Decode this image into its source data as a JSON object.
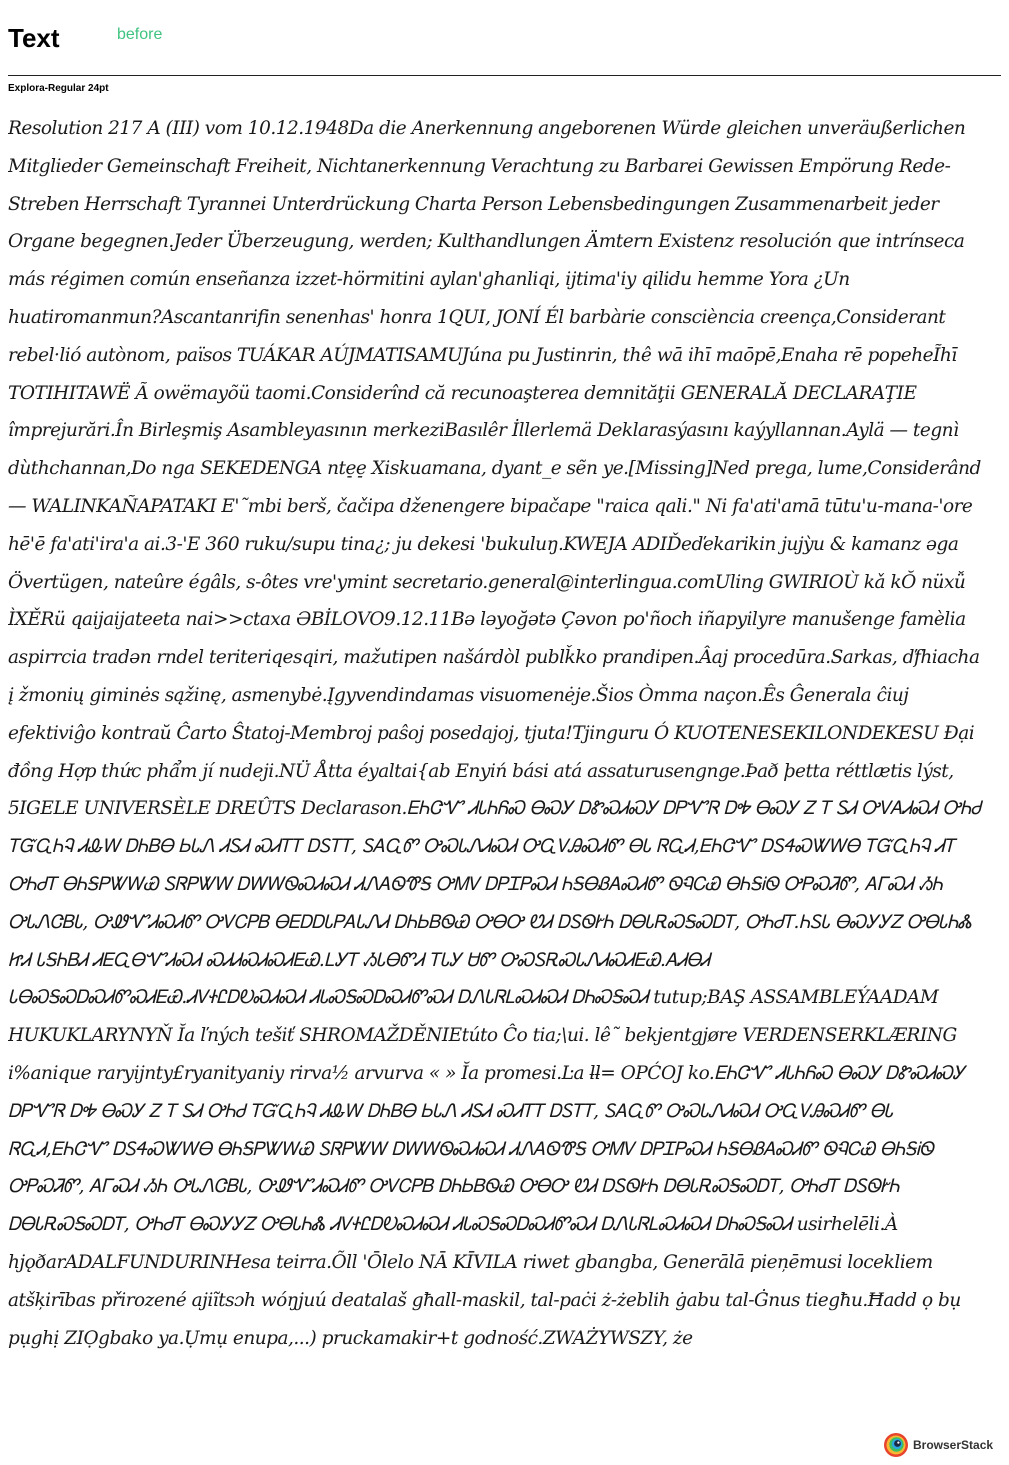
{
  "header": {
    "title": "Text",
    "tag": "before",
    "tag_color": "#3fc380"
  },
  "font_label": "Explora-Regular 24pt",
  "specimen_text": "Resolution 217 A (III) vom 10.12.1948Da die Anerkennung angeborenen Würde gleichen unveräußerlichen Mitglieder Gemeinschaft Freiheit, Nichtanerkennung Verachtung zu Barbarei Gewissen Empörung Rede- Streben Herrschaft Tyrannei Unterdrückung Charta Person Lebensbedingungen Zusammenarbeit jeder Organe begegnen.Jeder Überzeugung, werden; Kulthandlungen Ämtern Existenz resolución que intrínseca más régimen común enseñanza izzet-hörmitini aylan'ghanliqi, ijtima'iy qilidu hemme Yora ¿Un huatiromanmun?Ascantanrifin senenhas' honra 1QUI, JONÍ Él barbàrie consciència creença,Considerant rebel·lió autònom, països TUÁKAR AÚJMATISAMUJúna pu Justinrin, thê wā ihī maōpē,Enaha rē popeheĨhī TOTIHITAWË Ã owëmayõü taomi.Considerînd că recunoaşterea demnităţii GENERALĂ DECLARAŢIE împrejurări.În Birleşmiş Asambleyasının merkeziBasılêr İllerlemä Deklarasýasını kaýyllannan.Aylä — tegnì dùthchannan,Do nga SEKEDENGA nte̠e̠ Xiskuamana, dyant_e sẽn ye.[Missing]Ned prega, lume,Considerând — WALINKAÑAPATAKI E'˜mbi berš, čačipa dženengere bipačape \"raica qali.\" Ni fa'ati'amā tūtu'u-mana-'ore hē'ē fa'ati'ira'a ai.3-'E 360 ruku/supu tina¿; ju dekesi 'bukuluŋ.KWEJA ADIĎeďekarikin jujỳu & kamanz əga Övertügen, nateûre égâls, s-ôtes vre'ymint secretario.general@interlingua.comUling GWIRIOÙ kǎ kŎ nüxǚ ÌXĚRü qaijaijateeta nai>>ctaxa ƏBİLOVO9.12.11Bə ləyoğətə Çəvon po'ñoch iñapyilyre manušenge famèlia aspirrcia tradən rndel teriteriqesqiri, mažutipen našárdòl publǩko prandipen.Âaj procedūra.Sarkas, ďfhiacha į žmonių giminės sąžinę, asmenybė.Įgyvendindamas visuomenėje.Šios Òmma naçon.Ês Ĝenerala ĉiuj efektiviĝo kontraŭ Ĉarto Ŝtatoj-Membroj paŝoj posedajoj, tjuta!Tjinguru Ó KUOTENESEKILONDEKESU Đại đồng Hợp thức phẩm jí nudeji.NÜ Åtta éyaltai{ab Enyiń bási atá assaturusengnge.Það þetta réttlætis lýst, 5IGELE UNIVERSÈLE DREÛTS Declarason.ᎬᏂᏣᏉ ᏗᏓᏂᏲᏍ ᎾᏍᎩ ᎠᏑᏍᏗᏍᎩ ᎠᏢᏉᏒ ᎠᎭ ᎾᏍᎩ Ꮓ Ꭲ ᏚᏗ ᎤᏙᎪᏗᏍᏗ ᎤᏂᏧ ᎢᏳᏩᏂᎸ ᏗᎲᎳ ᎠᏂᏴᎾ ᏏᏓᏁ ᏗᏚᏗ ᏍᏗᎢᎢ ᎠᏚᎢᎢ, ᏚᎪᏩᏛ ᎤᏍᏓᏁᏗᏍᏗ ᎤᏩᏙᎯᏍᏗᏛ ᎾᏓ ᏒᏩᏗ,ᎬᏂᏣᏉ ᎠᏚᏎᏍᏔᎳᎾ ᎢᏳᏩᏂᎸ ᏗᎢ ᎤᏂᏧᎢ ᎾᏂᎦᏢᏔᎳᏯ ᏚᏒᏢᏔᎳ ᎠᎳᎳᏫᏍᏗᏍᏗ ᏗᏁᎪᏫᏡᎦ ᎤᎷᏙ ᎠᏢᏆᏢᏍᏗ ᏂᎦᎾᏰᎪᏍᏗᏛ ᏫᏄᏟᏯ ᎾᏂᎦᎥᏫ ᎤᏢᏍᏘᏛ, ᎪᎱᏍᏗ ᏱᏂ ᎤᏓᏁᏣᏴᏓ, ᎤᏪᏉᏗᏍᏗᏛ ᎤᏙᏟᏢᏴ ᎾᎬᎠᎠᏓᏢᎪᏓᏁᏗ ᎠᏂᏏᏴᏫᏯ ᎤᎾᎤ ᏬᏗ ᎠᏚᏫᎨᏂ ᎠᎾᏓᎡᏍᎦᏍᎠᎢ, ᎤᏂᏧᎢ.ᏂᏚᏓ ᎾᏍᎩᎩᏃ ᎤᎾᏓᏂᏜ ᏥᏗ ᏓᎦᏂᏴᏗ ᏗᎬᏩᎾᏉᏗᏍᏗ ᏍᏗᏗᏍᏗᏍᏗᎬᏯ.ᏞᎩᎢ ᏱᏓᎾᏛᏗ ᎢᏓᎩ ᏌᏛ ᎤᏍᏚᎡᏍᏓᏁᏗᏍᏗᎬᏯ.ᎪᏗᎾᏗ ᏓᎾᏍᎦᏍᎠᏍᏗᏛᏍᏗᎬᏯ.ᏗᏙᏐᏝᎠᎧᏍᏗᏍᏗ ᏗᏓᏍᎦᏍᎠᏍᏗᏛᏍᏗ ᎠᏁᏓᏒᏞᏍᏗᏍᏗ ᎠᏂᏍᎦᏍᏗ tutup;BAŞ ASSAMBLEÝAADAM HUKUKLARYNYŇ Ĭa ľných tešiť SHROMAŽDĚNIEtúto Ĉo tia;\\ui. lê˜ bekjentgjøre VERDENSERKLÆRING i%anique raryijnty£ryanityaniy rirva½ arvurva « » Ĭa promesi.Ŀa ƚƚ= OPĆOJ ko.ᎬᏂᏣᏉ ᏗᏓᏂᏲᏍ ᎾᏍᎩ ᎠᏑᏍᏗᏍᎩ ᎠᏢᏉᏒ ᎠᎭ ᎾᏍᎩ Ꮓ Ꭲ ᏚᏗ ᎤᏂᏧ ᎢᏳᏩᏂᎸ ᏗᎲᎳ ᎠᏂᏴᎾ ᏏᏓᏁ ᏗᏚᏗ ᏍᏗᎢᎢ ᎠᏚᎢᎢ, ᏚᎪᏩᏛ ᎤᏍᏓᏁᏗᏍᏗ ᎤᏩᏙᎯᏍᏗᏛ ᎾᏓ ᏒᏩᏗ,ᎬᏂᏣᏉ ᎠᏚᏎᏍᏔᎳᎾ ᎾᏂᎦᏢᏔᎳᏯ ᏚᏒᏢᏔᎳ ᎠᎳᎳᏫᏍᏗᏍᏗ ᏗᏁᎪᏫᏡᎦ ᎤᎷᏙ ᎠᏢᏆᏢᏍᏗ ᏂᎦᎾᏰᎪᏍᏗᏛ ᏫᏄᏟᏯ ᎾᏂᎦᎥᏫ ᎤᏢᏍᏘᏛ, ᎪᎱᏍᏗ ᏱᏂ ᎤᏓᏁᏣᏴᏓ, ᎤᏪᏉᏗᏍᏗᏛ ᎤᏙᏟᏢᏴ ᎠᏂᏏᏴᏫᏯ ᎤᎾᎤ ᏬᏗ ᎠᏚᏫᎨᏂ ᎠᎾᏓᎡᏍᎦᏍᎠᎢ, ᎤᏂᏧᎢ ᎠᏚᏫᎨᏂ ᎠᎾᏓᎡᏍᎦᏍᎠᎢ, ᎤᏂᏧᎢ ᎾᏍᎩᎩᏃ ᎤᎾᏓᏂᏜ ᏗᏙᏐᏝᎠᎧᏍᏗᏍᏗ ᏗᏓᏍᎦᏍᎠᏍᏗᏛᏍᏗ ᎠᏁᏓᏒᏞᏍᏗᏍᏗ ᎠᏂᏍᎦᏍᏗ usirhelēli.À hjǫðarADALFUNDURINHesa teirra.Õll 'Ōlelo NĀ KĪVILA riwet gbangba, Generālā pieņēmusi locekliem atšķirības přirozené ajiĩtsɔh wóŋjuú deatalaš għall-maskil, tal-paċi ż-żeblih ġabu tal-Ġnus tiegħu.Ħadd ọ bụ pụghị ZIỌgbako ya.Ụmụ enupa,...) pruckamakir+t godność.ZWAŻYWSZY, że",
  "branding": {
    "name": "BrowserStack"
  }
}
